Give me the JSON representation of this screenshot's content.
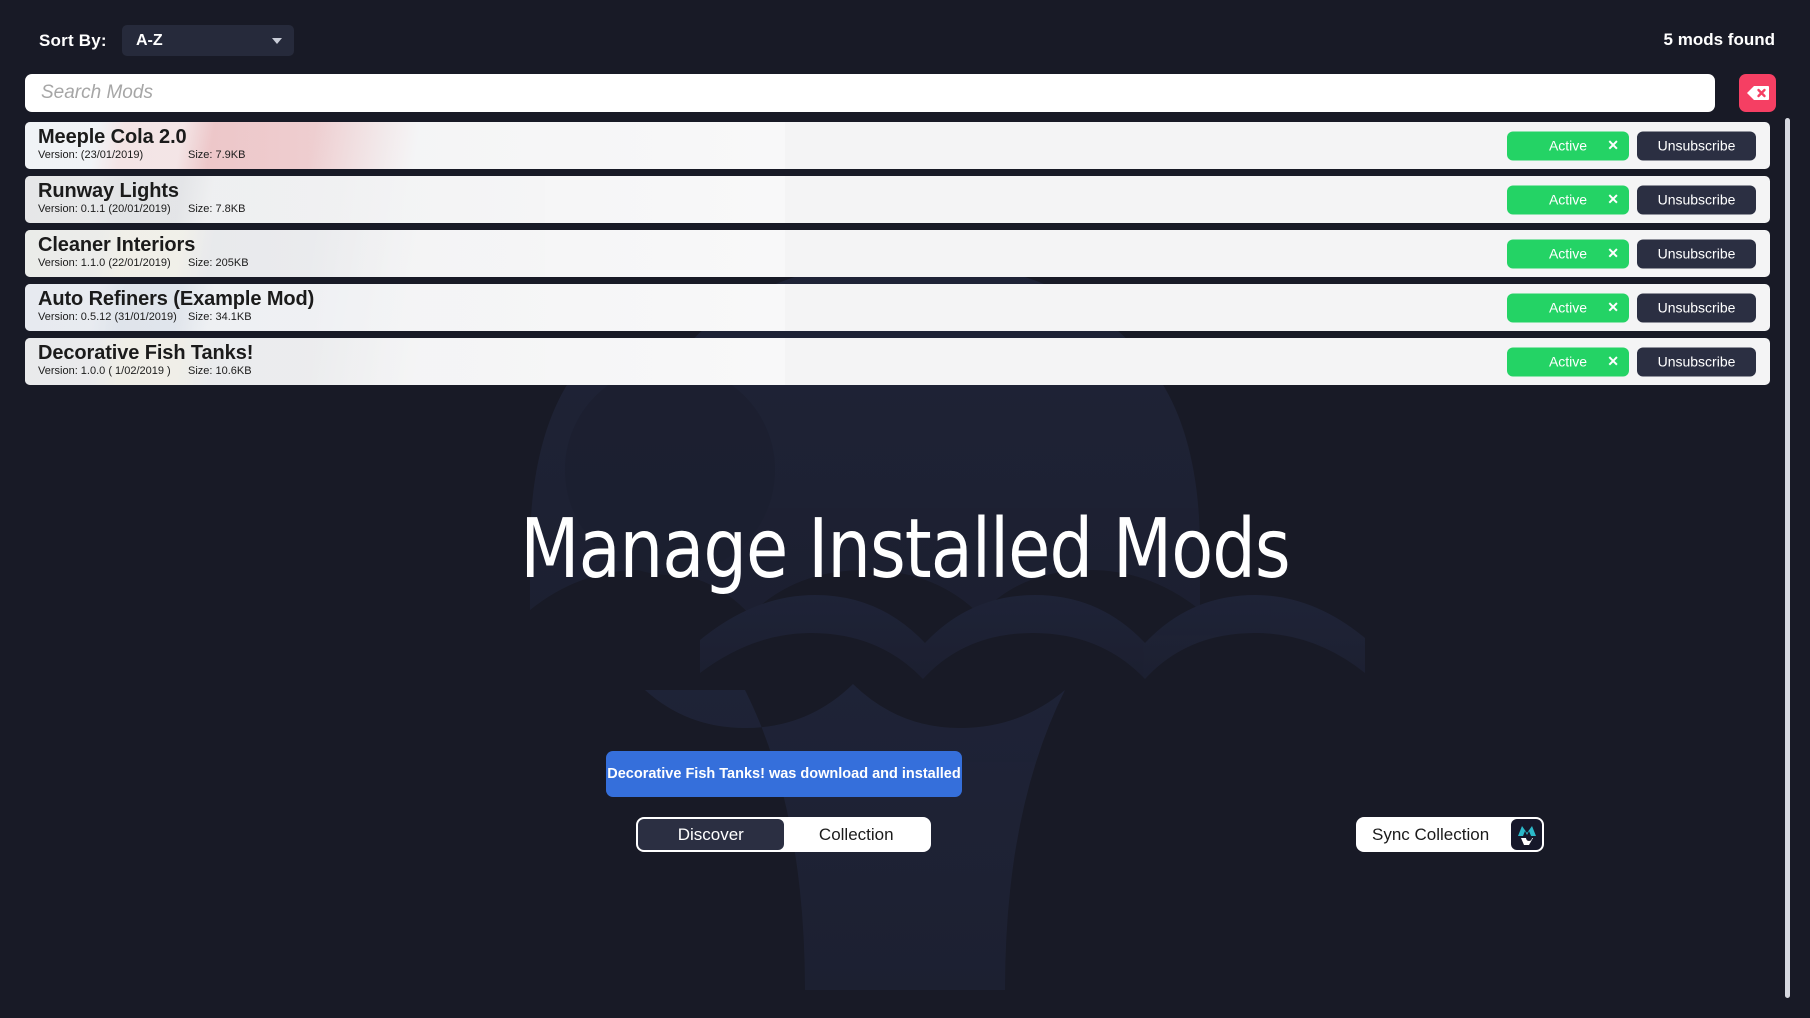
{
  "header": {
    "sort_label": "Sort By:",
    "sort_value": "A-Z",
    "sort_options": [
      "A-Z"
    ],
    "mods_found": "5 mods found",
    "caret_icon": "chevron-down-icon"
  },
  "search": {
    "placeholder": "Search Mods",
    "value": "",
    "clear_icon": "backspace-delete-icon",
    "clear_color": "#f53f63"
  },
  "mods": [
    {
      "title": "Meeple Cola 2.0",
      "version_label": "Version:",
      "version": "",
      "date": "(23/01/2019)",
      "size": "Size: 7.9KB",
      "active_label": "Active",
      "active_close_icon": "close-x-icon",
      "unsubscribe_label": "Unsubscribe",
      "thumb_colors": [
        "#e9f0f7",
        "#f2bfc0",
        "#d9494f",
        "#f4f6f8"
      ]
    },
    {
      "title": "Runway Lights",
      "version_label": "Version:",
      "version": "0.1.1",
      "date": "(20/01/2019)",
      "size": "Size: 7.8KB",
      "active_label": "Active",
      "active_close_icon": "close-x-icon",
      "unsubscribe_label": "Unsubscribe",
      "thumb_colors": [
        "#c9ccce",
        "#b9bec4",
        "#dfe2e5",
        "#eef0f1"
      ]
    },
    {
      "title": "Cleaner Interiors",
      "version_label": "Version:",
      "version": "1.1.0",
      "date": "(22/01/2019)",
      "size": "Size: 205KB",
      "active_label": "Active",
      "active_close_icon": "close-x-icon",
      "unsubscribe_label": "Unsubscribe",
      "thumb_colors": [
        "#d8dbd2",
        "#e8e4cb",
        "#c8ccd4",
        "#f0f1f2"
      ]
    },
    {
      "title": "Auto Refiners (Example Mod)",
      "version_label": "Version:",
      "version": "0.5.12",
      "date": "(31/01/2019)",
      "size": "Size: 34.1KB",
      "active_label": "Active",
      "active_close_icon": "close-x-icon",
      "unsubscribe_label": "Unsubscribe",
      "thumb_colors": [
        "#cdd7e6",
        "#aebfd4",
        "#dde4ec",
        "#f1f3f6"
      ]
    },
    {
      "title": "Decorative Fish Tanks!",
      "version_label": "Version:",
      "version": "1.0.0",
      "date": "( 1/02/2019 )",
      "size": "Size: 10.6KB",
      "active_label": "Active",
      "active_close_icon": "close-x-icon",
      "unsubscribe_label": "Unsubscribe",
      "thumb_colors": [
        "#d3d6d9",
        "#e4e0c6",
        "#cfd3d7",
        "#f2f3f4"
      ]
    }
  ],
  "hero": {
    "title": "Manage Installed Mods"
  },
  "toast": {
    "message": "Decorative Fish Tanks! was download and installed",
    "color": "#356fdb"
  },
  "segmented": {
    "discover_label": "Discover",
    "collection_label": "Collection",
    "selected": "Discover"
  },
  "sync": {
    "label": "Sync Collection",
    "icon": "mod-io-logo-icon",
    "icon_color": "#2bb9c9"
  },
  "theme": {
    "background": "#181a26",
    "accent_green": "#24d365",
    "accent_blue": "#356fdb",
    "accent_red": "#f53f63",
    "panel_dark": "#2b2f42"
  }
}
